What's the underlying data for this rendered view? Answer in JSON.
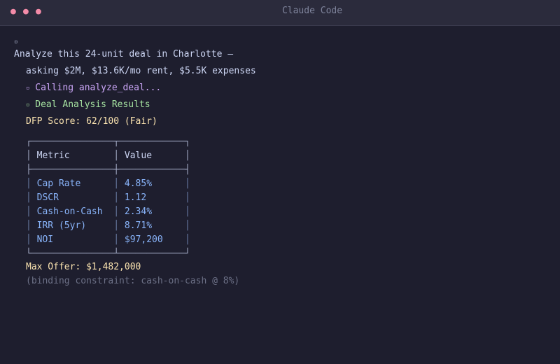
{
  "window": {
    "title": "Claude Code"
  },
  "prompt": {
    "marker": "▫",
    "line1": "Analyze this 24-unit deal in Charlotte —",
    "line2": "asking $2M, $13.6K/mo rent, $5.5K expenses"
  },
  "tool_call": {
    "marker": "▫",
    "text": "Calling analyze_deal..."
  },
  "result_header": {
    "marker": "▫",
    "text": "Deal Analysis Results"
  },
  "score": "DFP Score: 62/100 (Fair)",
  "table": {
    "headers": [
      "Metric",
      "Value"
    ],
    "rows": [
      {
        "metric": "Cap Rate",
        "value": "4.85%"
      },
      {
        "metric": "DSCR",
        "value": "1.12"
      },
      {
        "metric": "Cash-on-Cash",
        "value": "2.34%"
      },
      {
        "metric": "IRR (5yr)",
        "value": "8.71%"
      },
      {
        "metric": "NOI",
        "value": "$97,200"
      }
    ]
  },
  "max_offer": "Max Offer: $1,482,000",
  "constraint": "(binding constraint: cash-on-cash @ 8%)",
  "colors": {
    "background": "#1e1e2e",
    "dots": "#f38ba8",
    "tool_call": "#cba6f7",
    "success": "#a6e3a1",
    "highlight": "#f9e2af",
    "table_text": "#89b4fa"
  }
}
